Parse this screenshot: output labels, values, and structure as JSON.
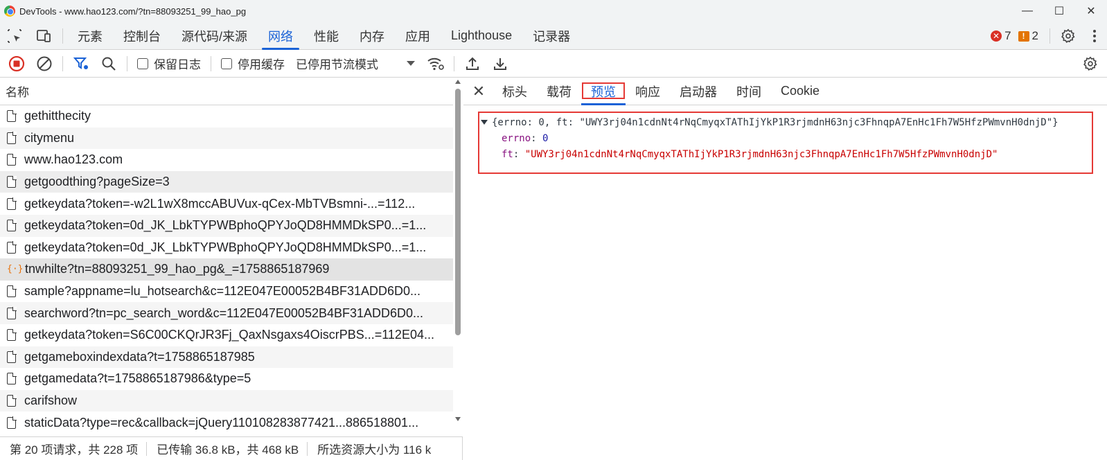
{
  "window": {
    "title": "DevTools - www.hao123.com/?tn=88093251_99_hao_pg",
    "controls": {
      "minimize": "—",
      "maximize": "☐",
      "close": "✕"
    }
  },
  "main_tabs": [
    "元素",
    "控制台",
    "源代码/来源",
    "网络",
    "性能",
    "内存",
    "应用",
    "Lighthouse",
    "记录器"
  ],
  "active_main_tab": "网络",
  "issues": {
    "errors": "7",
    "warnings": "2"
  },
  "network_toolbar": {
    "preserve_log": "保留日志",
    "disable_cache": "停用缓存",
    "throttling": "已停用节流模式"
  },
  "request_list": {
    "column_name": "名称",
    "rows": [
      {
        "name": "gethitthecity",
        "type": "doc"
      },
      {
        "name": "citymenu",
        "type": "doc"
      },
      {
        "name": "www.hao123.com",
        "type": "doc"
      },
      {
        "name": "getgoodthing?pageSize=3",
        "type": "doc"
      },
      {
        "name": "getkeydata?token=-w2L1wX8mccABUVux-qCex-MbTVBsmni-...=112...",
        "type": "doc"
      },
      {
        "name": "getkeydata?token=0d_JK_LbkTYPWBphoQPYJoQD8HMMDkSP0...=1...",
        "type": "doc"
      },
      {
        "name": "getkeydata?token=0d_JK_LbkTYPWBphoQPYJoQD8HMMDkSP0...=1...",
        "type": "doc"
      },
      {
        "name": "tnwhilte?tn=88093251_99_hao_pg&_=1758865187969",
        "type": "xhr"
      },
      {
        "name": "sample?appname=lu_hotsearch&c=112E047E00052B4BF31ADD6D0...",
        "type": "doc"
      },
      {
        "name": "searchword?tn=pc_search_word&c=112E047E00052B4BF31ADD6D0...",
        "type": "doc"
      },
      {
        "name": "getkeydata?token=S6C00CKQrJR3Fj_QaxNsgaxs4OiscrPBS...=112E04...",
        "type": "doc"
      },
      {
        "name": "getgameboxindexdata?t=1758865187985",
        "type": "doc"
      },
      {
        "name": "getgamedata?t=1758865187986&type=5",
        "type": "doc"
      },
      {
        "name": "carifshow",
        "type": "doc"
      },
      {
        "name": "staticData?type=rec&callback=jQuery110108283877421...886518801...",
        "type": "doc"
      }
    ]
  },
  "status": {
    "requests": "第 20 项请求，共 228 项",
    "transferred": "已传输 36.8 kB，共 468 kB",
    "resources": "所选资源大小为 116 k"
  },
  "detail_tabs": [
    "标头",
    "载荷",
    "预览",
    "响应",
    "启动器",
    "时间",
    "Cookie"
  ],
  "active_detail_tab": "预览",
  "preview": {
    "summary_prefix": "{errno: 0, ft: ",
    "summary_value": "\"UWY3rj04n1cdnNt4rNqCmyqxTAThIjYkP1R3rjmdnH63njc3FhnqpA7EnHc1Fh7W5HfzPWmvnH0dnjD\"",
    "summary_suffix": "}",
    "errno_key": "errno",
    "errno_value": "0",
    "ft_key": "ft",
    "ft_value": "\"UWY3rj04n1cdnNt4rNqCmyqxTAThIjYkP1R3rjmdnH63njc3FhnqpA7EnHc1Fh7W5HfzPWmvnH0dnjD\""
  },
  "colors": {
    "accent": "#1a62d6",
    "highlight_border": "#e53935",
    "error": "#d93025",
    "warning": "#e37400"
  }
}
